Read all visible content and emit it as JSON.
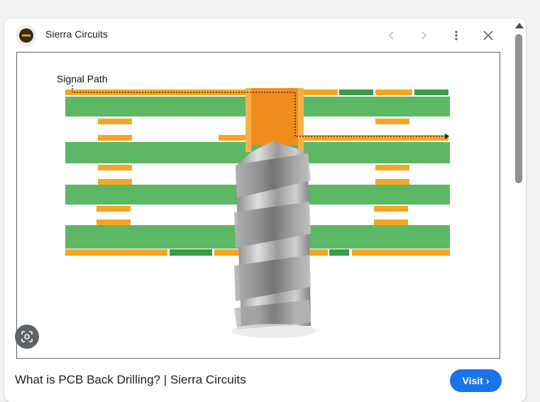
{
  "header": {
    "site_name": "Sierra Circuits",
    "icons": [
      "site-logo-icon",
      "back-arrow-icon",
      "forward-arrow-icon",
      "more-vert-icon",
      "close-icon"
    ]
  },
  "image": {
    "signal_label": "Signal Path"
  },
  "caption": {
    "title": "What is PCB Back Drilling? | Sierra Circuits"
  },
  "visit": {
    "label": "Visit",
    "chevron": "›"
  },
  "colors": {
    "accent": "#1a73e8",
    "board_green": "#5cb865",
    "copper": "#f5a623",
    "drill_grey": "#a0a0a0"
  }
}
